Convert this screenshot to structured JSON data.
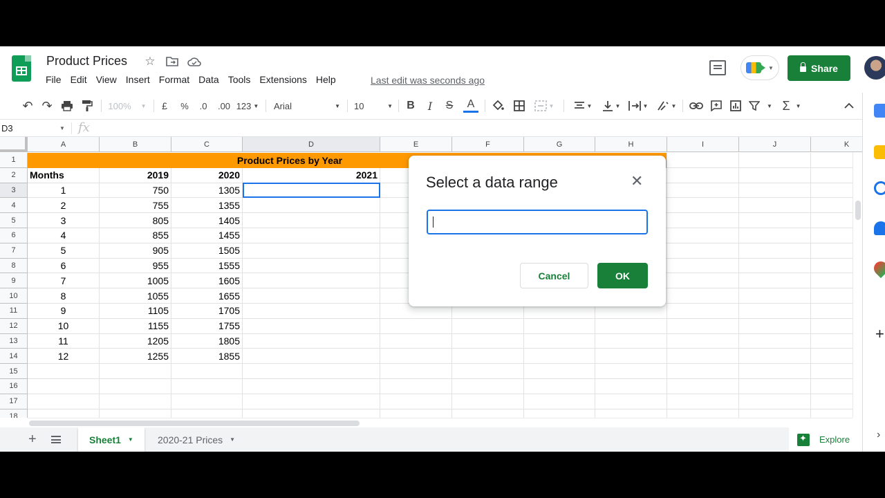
{
  "header": {
    "title": "Product Prices",
    "menu": [
      "File",
      "Edit",
      "View",
      "Insert",
      "Format",
      "Data",
      "Tools",
      "Extensions",
      "Help"
    ],
    "last_edit": "Last edit was seconds ago",
    "share_label": "Share"
  },
  "toolbar": {
    "zoom": "100%",
    "currency": "£",
    "percent": "%",
    "dec_decrease": ".0",
    "dec_increase": ".00",
    "more_formats": "123",
    "font": "Arial",
    "font_size": "10"
  },
  "formula_bar": {
    "name_box": "D3",
    "fx": "fx"
  },
  "grid": {
    "columns": [
      "A",
      "B",
      "C",
      "D",
      "E",
      "F",
      "G",
      "H",
      "I",
      "J",
      "K"
    ],
    "rows": [
      "1",
      "2",
      "3",
      "4",
      "5",
      "6",
      "7",
      "8",
      "9",
      "10",
      "11",
      "12",
      "13",
      "14",
      "15",
      "16",
      "17",
      "18"
    ],
    "title": "Product Prices by Year",
    "headers": [
      "Months",
      "2019",
      "2020",
      "2021"
    ],
    "data": [
      [
        "1",
        "750",
        "1305"
      ],
      [
        "2",
        "755",
        "1355"
      ],
      [
        "3",
        "805",
        "1405"
      ],
      [
        "4",
        "855",
        "1455"
      ],
      [
        "5",
        "905",
        "1505"
      ],
      [
        "6",
        "955",
        "1555"
      ],
      [
        "7",
        "1005",
        "1605"
      ],
      [
        "8",
        "1055",
        "1655"
      ],
      [
        "9",
        "1105",
        "1705"
      ],
      [
        "10",
        "1155",
        "1755"
      ],
      [
        "11",
        "1205",
        "1805"
      ],
      [
        "12",
        "1255",
        "1855"
      ]
    ]
  },
  "sheets": {
    "tabs": [
      "Sheet1",
      "2020-21 Prices"
    ],
    "explore": "Explore"
  },
  "dialog": {
    "title": "Select a data range",
    "input_value": "",
    "cancel": "Cancel",
    "ok": "OK"
  },
  "colors": {
    "brand_green": "#188038",
    "title_fill": "#ff9900",
    "selection_blue": "#1a73e8"
  }
}
